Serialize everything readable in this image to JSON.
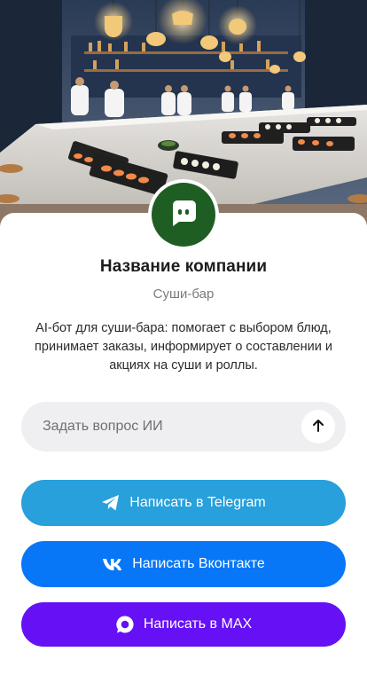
{
  "company": {
    "name": "Название компании",
    "type": "Суши-бар",
    "description": "AI-бот для суши-бара: помогает с выбором блюд, принимает заказы, информирует о составлении и акциях на суши и роллы."
  },
  "ask": {
    "placeholder": "Задать вопрос ИИ"
  },
  "buttons": {
    "telegram": {
      "label": "Написать в Telegram",
      "color": "#27a0dc",
      "icon": "telegram-plane-icon"
    },
    "vk": {
      "label": "Написать Вконтакте",
      "color": "#0877f7",
      "icon": "vk-logo-icon"
    },
    "max": {
      "label": "Написать в MAX",
      "color": "#6510f5",
      "icon": "max-logo-icon"
    }
  },
  "colors": {
    "avatar_bg": "#1e5e23",
    "ask_bg": "#efeff2"
  },
  "hero": {
    "icon": "sushi-bar-photo"
  }
}
